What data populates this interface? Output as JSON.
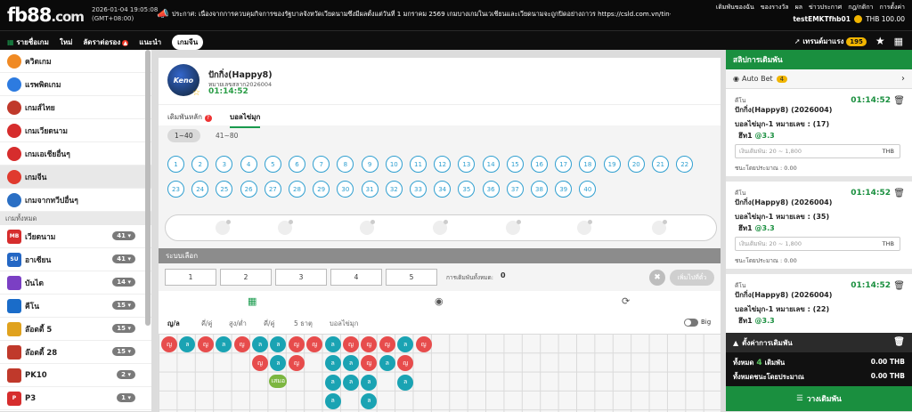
{
  "header": {
    "logo_main": "fb88",
    "logo_tld": ".com",
    "date": "2026-01-04 19:05:08",
    "tz": "(GMT+08:00)",
    "announcement": "ประกาศ: เนื่องจากการควบคุมกิจการของรัฐบาลจังหวัดเวียดนามซึ่งมีผลตั้งแต่วันที่ 1 มกราคม 2569 เกมบางเกมในเวเชียนและเวียดนามจะถูกปิดอย่างถาวร https://csld.com.vn/tin-tu",
    "nav": [
      "เดิมพันของฉัน",
      "ของรางวัล",
      "ผล",
      "ข่าวประกาศ",
      "กฎ/กติกา",
      "การตั้งค่า"
    ],
    "username": "testEMKTfhb01",
    "balance": "THB 100.00"
  },
  "navbar": {
    "items": [
      "รายชื่อเกม",
      "ใหม่",
      "ลัดราต่อรอง",
      "แนะนำ",
      "เกมจีน"
    ],
    "trend_label": "เทรนด์มาแรง",
    "trend_count": "195"
  },
  "sidebar": {
    "top": [
      {
        "label": "ควิดเกม",
        "color": "#f08a24"
      },
      {
        "label": "แรพพิดเกม",
        "color": "#2d7be0"
      },
      {
        "label": "เกมส์ไทย",
        "color": "#c0392b"
      },
      {
        "label": "เกมเวียดนาม",
        "color": "#d62d2d"
      },
      {
        "label": "เกมเอเชียอื่นๆ",
        "color": "#d62d2d"
      },
      {
        "label": "เกมจีน",
        "color": "#e03a2e"
      },
      {
        "label": "เกมจากทวีปอื่นๆ",
        "color": "#2a6fc4"
      }
    ],
    "section": "เกมทั้งหมด",
    "list": [
      {
        "label": "เวียดนาม",
        "badge": "41",
        "color": "#d62d2d",
        "icon": "MB"
      },
      {
        "label": "อาเซียน",
        "badge": "41",
        "color": "#2467c4",
        "icon": "SU"
      },
      {
        "label": "บันได",
        "badge": "14",
        "color": "#7b3fc4",
        "icon": ""
      },
      {
        "label": "คีโน",
        "badge": "15",
        "color": "#1a6cc9",
        "icon": ""
      },
      {
        "label": "ล๊อตตี้ 5",
        "badge": "15",
        "color": "#e0a21e",
        "icon": ""
      },
      {
        "label": "ล๊อตตี้ 28",
        "badge": "15",
        "color": "#c0392b",
        "icon": ""
      },
      {
        "label": "PK10",
        "badge": "2",
        "color": "#c0392b",
        "icon": ""
      },
      {
        "label": "P3",
        "badge": "1",
        "color": "#d62d2d",
        "icon": "P"
      }
    ]
  },
  "game": {
    "title": "ปักกิ่ง(Happy8)",
    "draw_label": "หมายเลขสลาก2026004",
    "countdown": "01:14:52",
    "icon_text": "Keno",
    "tabs": [
      "เดิมพันหลัก",
      "บอลไข่มุก"
    ],
    "ranges": [
      "1~40",
      "41~80"
    ],
    "numbers": [
      "1",
      "2",
      "3",
      "4",
      "5",
      "6",
      "7",
      "8",
      "9",
      "10",
      "11",
      "12",
      "13",
      "14",
      "15",
      "16",
      "17",
      "18",
      "19",
      "20",
      "21",
      "22",
      "23",
      "24",
      "25",
      "26",
      "27",
      "28",
      "29",
      "30",
      "31",
      "32",
      "33",
      "34",
      "35",
      "36",
      "37",
      "38",
      "39",
      "40"
    ]
  },
  "system": {
    "title": "ระบบเลือก",
    "buttons": [
      "1",
      "2",
      "3",
      "4",
      "5"
    ],
    "total_label": "การเดิมพันทั้งหมด:",
    "total_value": "0",
    "add_label": "เพิ่มไปที่ตั๋ว"
  },
  "results": {
    "tabs": [
      "ญ/ล",
      "คี่/คู่",
      "สูง/ต่ำ",
      "คี่/คู่",
      "5 ธาตุ",
      "บอลไข่มุก"
    ],
    "big_label": "Big",
    "cols": [
      [
        "ญ"
      ],
      [
        "ล"
      ],
      [
        "ญ"
      ],
      [
        "ล"
      ],
      [
        "ญ"
      ],
      [
        "ล",
        "ญ"
      ],
      [
        "ล",
        "ล",
        "เสมอ"
      ],
      [
        "ญ",
        "ญ"
      ],
      [
        "ญ"
      ],
      [
        "ล",
        "ล",
        "ล",
        "ล"
      ],
      [
        "ญ",
        "ล",
        "ล"
      ],
      [
        "ญ",
        "ญ",
        "ล",
        "ล"
      ],
      [
        "ญ",
        "ล"
      ],
      [
        "ล",
        "ญ",
        "ล"
      ],
      [
        "ญ"
      ]
    ]
  },
  "betslip": {
    "title": "สลิปการเดิมพัน",
    "autobet_label": "Auto Bet",
    "autobet_count": "4",
    "slips": [
      {
        "type": "คีโน",
        "game": "ปักกิ่ง(Happy8) (2026004)",
        "time": "01:14:52",
        "selection": "บอลไข่มุก-1 หมายเลข : (17)",
        "odds_label": "ฮึท1",
        "odds": "@3.3",
        "placeholder": "เงินเดิมพัน: 20 ~ 1,800",
        "currency": "THB",
        "est": "ชนะโดยประมาณ : 0.00"
      },
      {
        "type": "คีโน",
        "game": "ปักกิ่ง(Happy8) (2026004)",
        "time": "01:14:52",
        "selection": "บอลไข่มุก-1 หมายเลข : (35)",
        "odds_label": "ฮึท1",
        "odds": "@3.3",
        "placeholder": "เงินเดิมพัน: 20 ~ 1,800",
        "currency": "THB",
        "est": "ชนะโดยประมาณ : 0.00"
      },
      {
        "type": "คีโน",
        "game": "ปักกิ่ง(Happy8) (2026004)",
        "time": "01:14:52",
        "selection": "บอลไข่มุก-1 หมายเลข : (22)",
        "odds_label": "ฮึท1",
        "odds": "@3.3",
        "placeholder": "",
        "currency": "",
        "est": ""
      }
    ],
    "settings_label": "ตั้งค่าการเดิมพัน",
    "total_label": "ทั้งหมด",
    "total_count": "4",
    "total_unit": "เดิมพัน",
    "total_value": "0.00 THB",
    "est_label": "ทั้งหมดชนะโดยประมาณ",
    "est_value": "0.00 THB",
    "place_label": "วางเดิมพัน"
  }
}
